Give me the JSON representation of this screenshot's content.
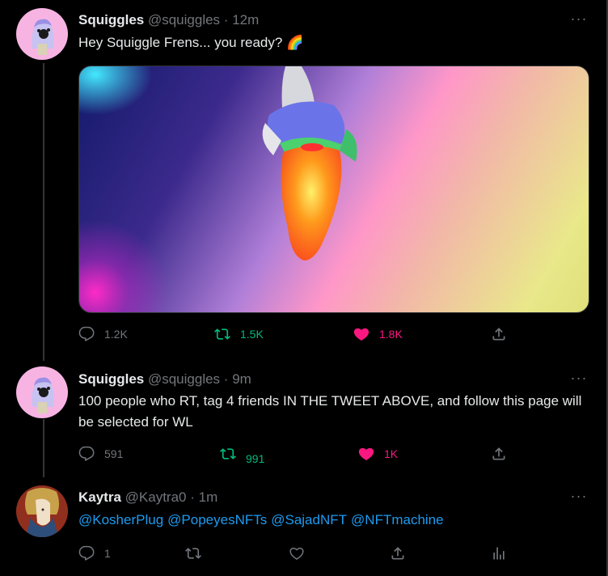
{
  "tweets": [
    {
      "name": "Squiggles",
      "handle": "@squiggles",
      "sep": "·",
      "time": "12m",
      "text": "Hey Squiggle Frens... you ready? 🌈",
      "stats": {
        "replies": "1.2K",
        "retweets": "1.5K",
        "likes": "1.8K"
      }
    },
    {
      "name": "Squiggles",
      "handle": "@squiggles",
      "sep": "·",
      "time": "9m",
      "text": "100 people who RT, tag 4 friends IN THE TWEET ABOVE, and follow this page will be selected for WL",
      "stats": {
        "replies": "591",
        "retweets": "991",
        "likes": "1K"
      }
    },
    {
      "name": "Kaytra",
      "handle": "@Kaytra0",
      "sep": "·",
      "time": "1m",
      "mentions": [
        "@KosherPlug",
        "@PopeyesNFTs",
        "@SajadNFT",
        "@NFTmachine"
      ],
      "stats": {
        "replies": "1"
      }
    }
  ],
  "more_icon": "···",
  "colors": {
    "accent": "#1d9bf0",
    "retweet": "#00ba7c",
    "like": "#f91880",
    "muted": "#71767b"
  }
}
